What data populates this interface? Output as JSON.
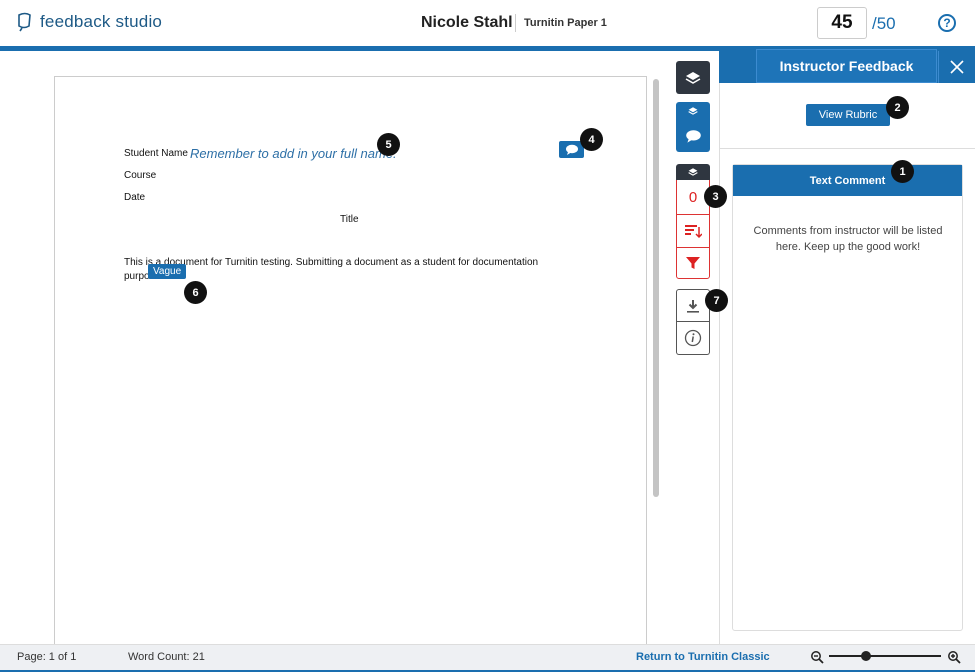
{
  "header": {
    "logo_text": "feedback studio",
    "student_name": "Nicole Stahl",
    "paper_title": "Turnitin Paper 1",
    "score": "45",
    "score_max": "/50",
    "help_label": "?"
  },
  "document": {
    "lines": {
      "student_name_label": "Student Name",
      "course": "Course",
      "date": "Date",
      "title": "Title",
      "body_line1": "This is a document for Turnitin testing. Submitting a document as a student for documentation",
      "body_line2": "purpo"
    },
    "handwritten_comment": "Remember to add in your full name.",
    "quickmark_label": "Vague"
  },
  "markers": [
    "1",
    "2",
    "3",
    "4",
    "5",
    "6",
    "7"
  ],
  "tools": {
    "similarity_score": "0"
  },
  "panel": {
    "title": "Instructor Feedback",
    "view_rubric_label": "View Rubric",
    "card_title": "Text Comment",
    "card_text": "Comments from instructor will be listed here. Keep up the good work!"
  },
  "footer": {
    "page": "Page: 1 of 1",
    "word_count": "Word Count: 21",
    "return_link": "Return to Turnitin Classic",
    "zoom_level": 0.33
  },
  "icons": {
    "logo": "feedback-studio-logo-icon",
    "help": "help-circle-icon",
    "layers": "layers-icon",
    "comment": "comment-bubble-icon",
    "sort": "sort-filter-icon",
    "filter": "funnel-icon",
    "download": "download-icon",
    "info": "info-circle-icon",
    "close": "close-icon",
    "zoom_out": "zoom-out-icon",
    "zoom_in": "zoom-in-icon"
  },
  "colors": {
    "brand_blue": "#1a6eaf",
    "dark_tool": "#2f3640",
    "similarity_red": "#d22222"
  }
}
